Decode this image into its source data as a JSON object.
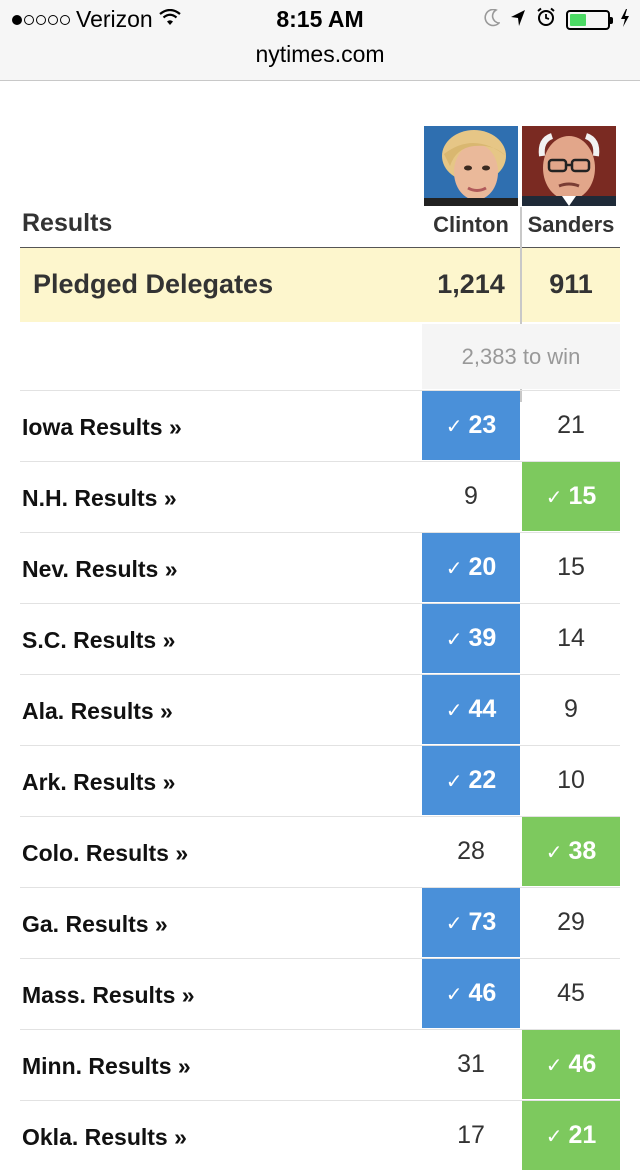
{
  "status": {
    "carrier": "Verizon",
    "signal_dots_filled": 1,
    "signal_dots_total": 5,
    "time": "8:15 AM",
    "url": "nytimes.com",
    "icons": [
      "wifi-icon",
      "moon-icon",
      "location-arrow-icon",
      "alarm-icon",
      "battery-icon",
      "charging-icon"
    ],
    "battery_level": 0.45
  },
  "header": {
    "label": "Results",
    "candidates": [
      "Clinton",
      "Sanders"
    ]
  },
  "pledged": {
    "label": "Pledged Delegates",
    "clinton": "1,214",
    "sanders": "911"
  },
  "to_win": "2,383 to win",
  "colors": {
    "clinton_win": "#4a90d9",
    "sanders_win": "#7dc95e",
    "pledged_bg": "#fdf6cd"
  },
  "rows": [
    {
      "state": "Iowa Results »",
      "clinton": "23",
      "sanders": "21",
      "winner": "clinton"
    },
    {
      "state": "N.H. Results »",
      "clinton": "9",
      "sanders": "15",
      "winner": "sanders"
    },
    {
      "state": "Nev. Results »",
      "clinton": "20",
      "sanders": "15",
      "winner": "clinton"
    },
    {
      "state": "S.C. Results »",
      "clinton": "39",
      "sanders": "14",
      "winner": "clinton"
    },
    {
      "state": "Ala. Results »",
      "clinton": "44",
      "sanders": "9",
      "winner": "clinton"
    },
    {
      "state": "Ark. Results »",
      "clinton": "22",
      "sanders": "10",
      "winner": "clinton"
    },
    {
      "state": "Colo. Results »",
      "clinton": "28",
      "sanders": "38",
      "winner": "sanders"
    },
    {
      "state": "Ga. Results »",
      "clinton": "73",
      "sanders": "29",
      "winner": "clinton"
    },
    {
      "state": "Mass. Results »",
      "clinton": "46",
      "sanders": "45",
      "winner": "clinton"
    },
    {
      "state": "Minn. Results »",
      "clinton": "31",
      "sanders": "46",
      "winner": "sanders"
    },
    {
      "state": "Okla. Results »",
      "clinton": "17",
      "sanders": "21",
      "winner": "sanders"
    }
  ]
}
